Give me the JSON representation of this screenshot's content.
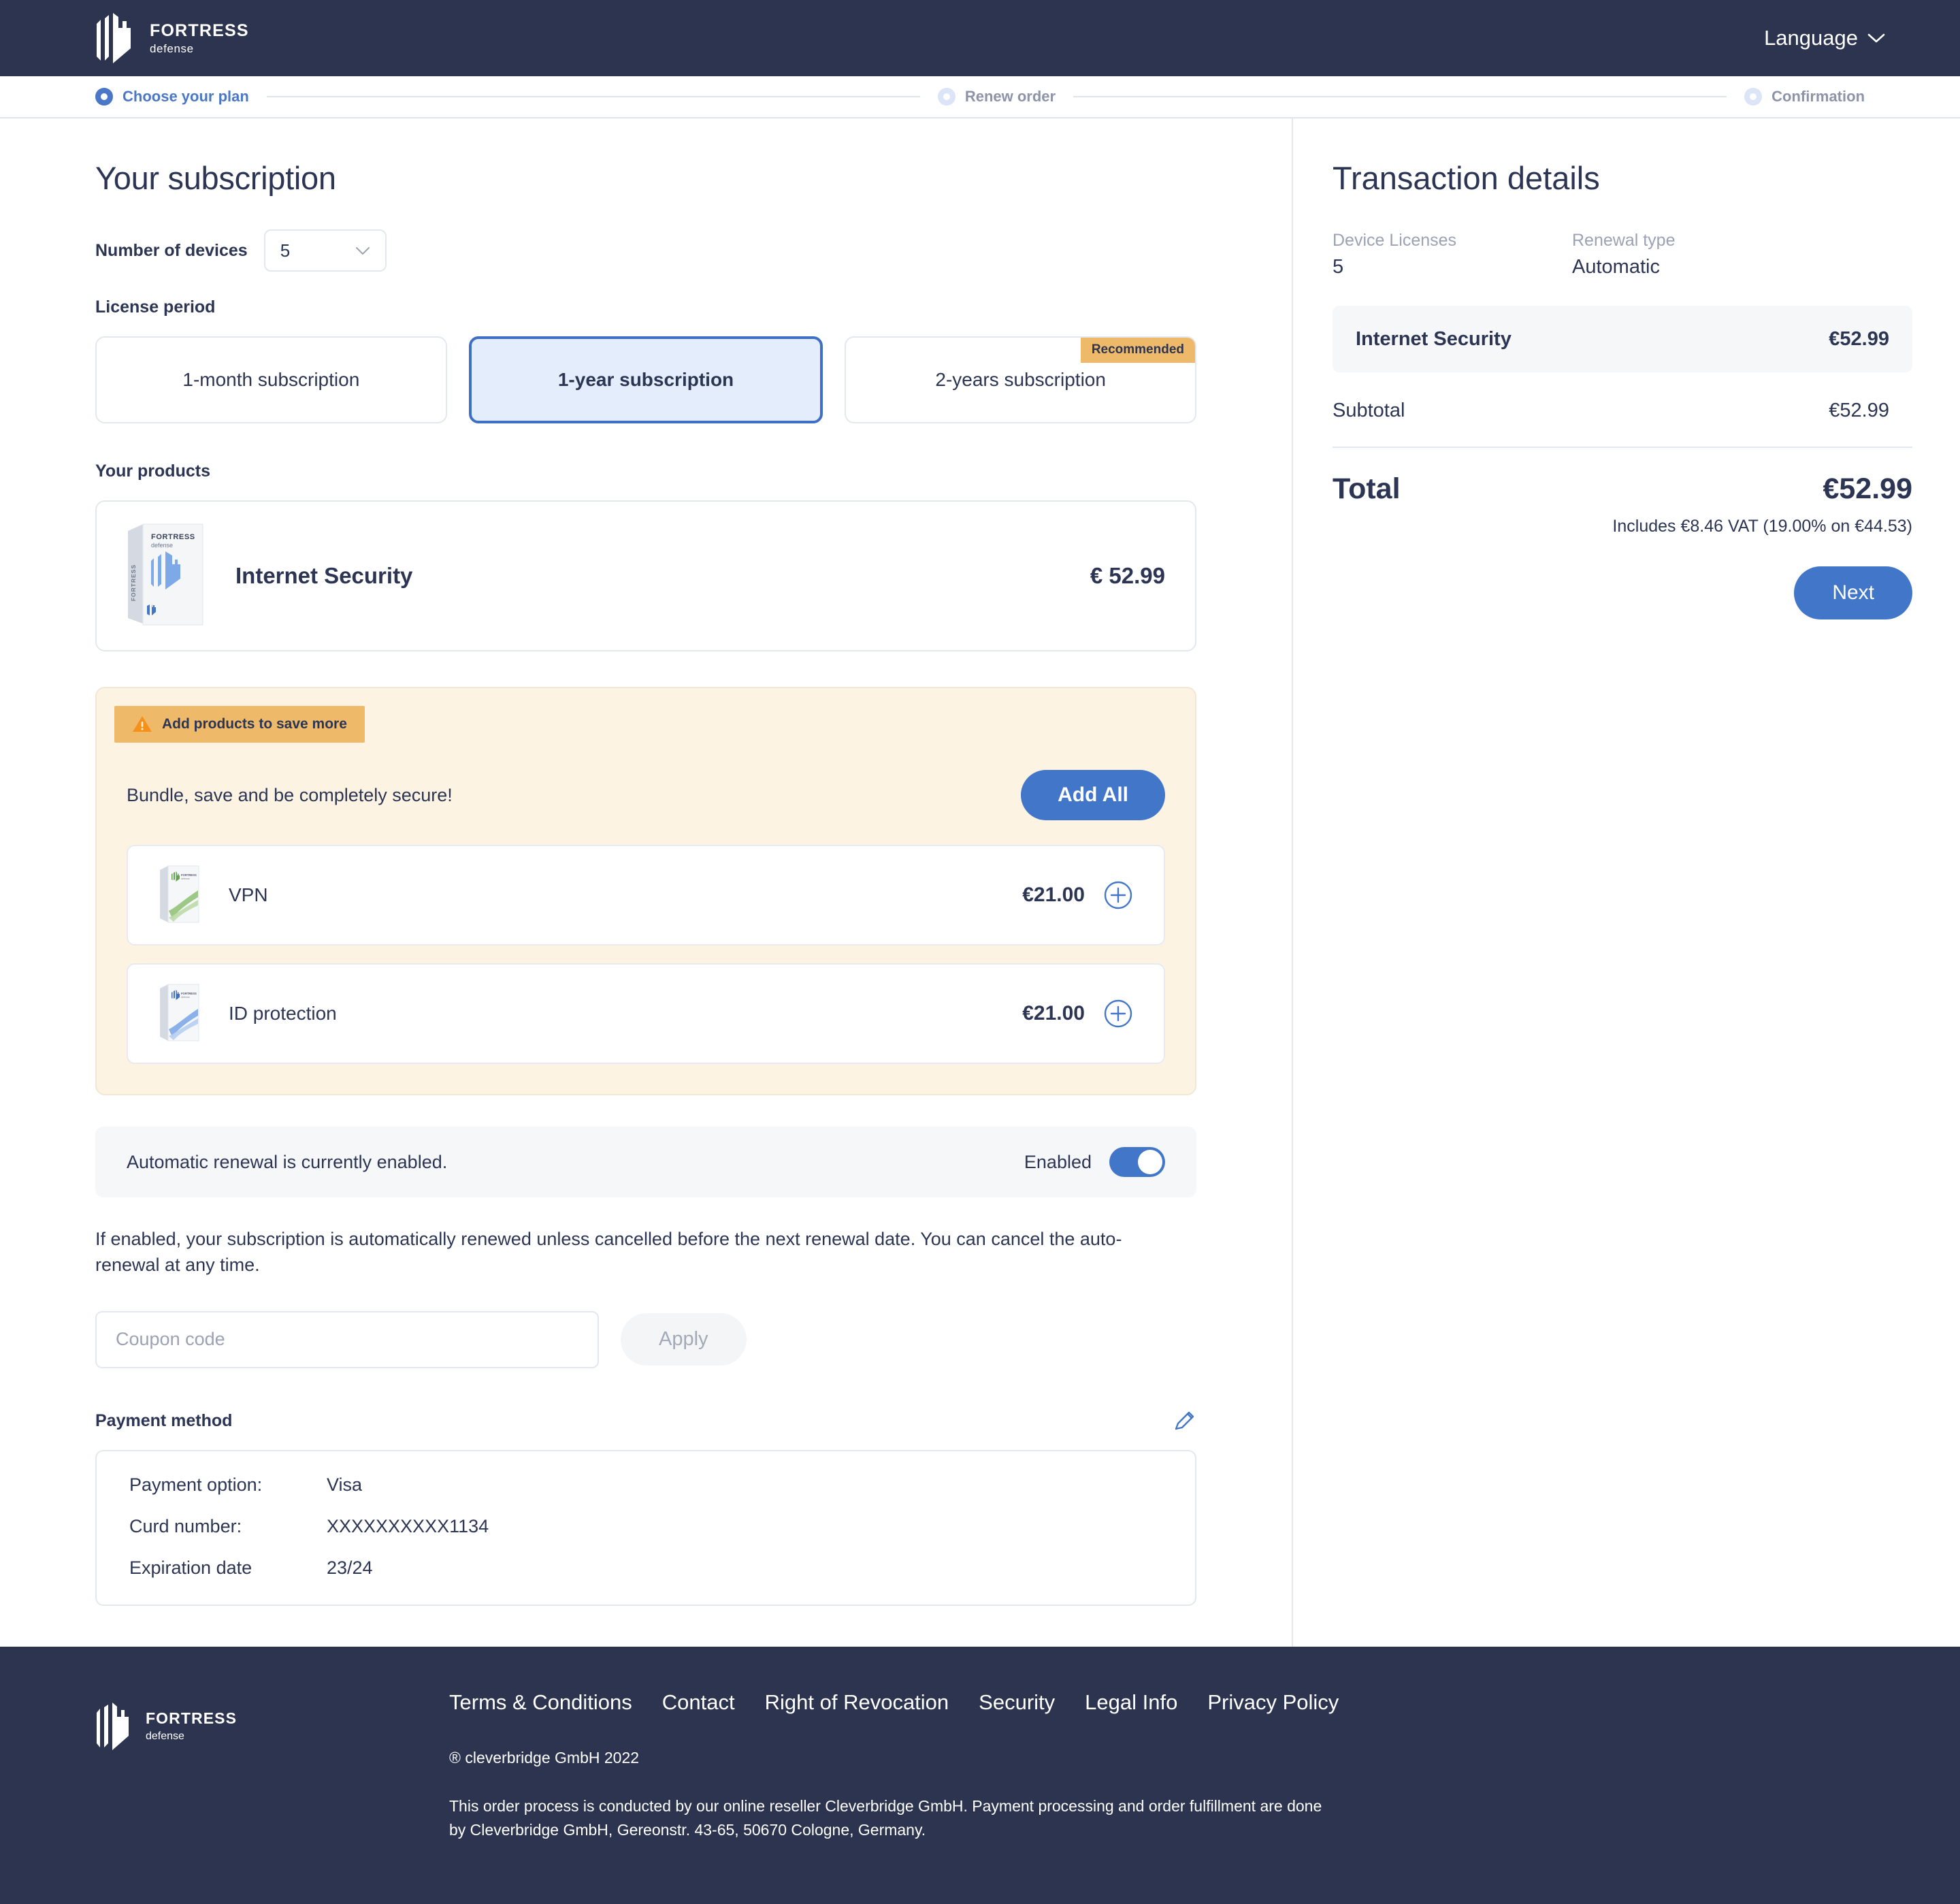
{
  "header": {
    "brand_name": "FORTRESS",
    "brand_sub": "defense",
    "language_label": "Language"
  },
  "stepper": {
    "steps": [
      {
        "label": "Choose your plan",
        "state": "active"
      },
      {
        "label": "Renew order",
        "state": "pending"
      },
      {
        "label": "Confirmation",
        "state": "pending"
      }
    ]
  },
  "subscription": {
    "title": "Your subscription",
    "devices_label": "Number of devices",
    "devices_value": "5",
    "license_period_label": "License period",
    "periods": [
      {
        "label": "1-month subscription",
        "selected": false,
        "badge": ""
      },
      {
        "label": "1-year subscription",
        "selected": true,
        "badge": ""
      },
      {
        "label": "2-years subscription",
        "selected": false,
        "badge": "Recommended"
      }
    ],
    "products_label": "Your products",
    "product": {
      "name": "Internet Security",
      "price": "€ 52.99",
      "box_brand": "FORTRESS",
      "box_sub": "defense"
    }
  },
  "upsell": {
    "banner_text": "Add products to save more",
    "headline": "Bundle, save and be completely secure!",
    "add_all_label": "Add All",
    "items": [
      {
        "name": "VPN",
        "price": "€21.00"
      },
      {
        "name": "ID protection",
        "price": "€21.00"
      }
    ]
  },
  "renewal": {
    "status_text": "Automatic renewal is currently enabled.",
    "toggle_state_label": "Enabled",
    "note": "If enabled, your subscription is automatically renewed unless cancelled before the next renewal date. You can cancel the auto-renewal at any time."
  },
  "coupon": {
    "placeholder": "Coupon code",
    "value": "",
    "apply_label": "Apply"
  },
  "payment": {
    "section_label": "Payment method",
    "rows": [
      {
        "key": "Payment option:",
        "value": "Visa"
      },
      {
        "key": "Curd number:",
        "value": "XXXXXXXXXX1134"
      },
      {
        "key": "Expiration date",
        "value": "23/24"
      }
    ]
  },
  "transaction": {
    "title": "Transaction details",
    "device_licenses_label": "Device Licenses",
    "device_licenses_value": "5",
    "renewal_type_label": "Renewal type",
    "renewal_type_value": "Automatic",
    "line_item_name": "Internet Security",
    "line_item_price": "€52.99",
    "subtotal_label": "Subtotal",
    "subtotal_value": "€52.99",
    "total_label": "Total",
    "total_value": "€52.99",
    "vat_note": "Includes €8.46 VAT (19.00% on €44.53)",
    "next_label": "Next"
  },
  "footer": {
    "brand_name": "FORTRESS",
    "brand_sub": "defense",
    "links": [
      "Terms & Conditions",
      "Contact",
      "Right of Revocation",
      "Security",
      "Legal Info",
      "Privacy Policy"
    ],
    "copyright": "® cleverbridge GmbH 2022",
    "legal_line1": "This order process is conducted by our online reseller Cleverbridge GmbH. Payment processing and order fulfillment are done",
    "legal_line2": "by Cleverbridge GmbH, Gereonstr. 43-65, 50670 Cologne, Germany."
  },
  "colors": {
    "navy": "#2d344f",
    "accent_blue": "#4176c9",
    "selected_bg": "#e4edfb",
    "amber": "#eeba6a",
    "upsell_bg": "#fcf3e3",
    "muted": "#9aa2b4"
  }
}
